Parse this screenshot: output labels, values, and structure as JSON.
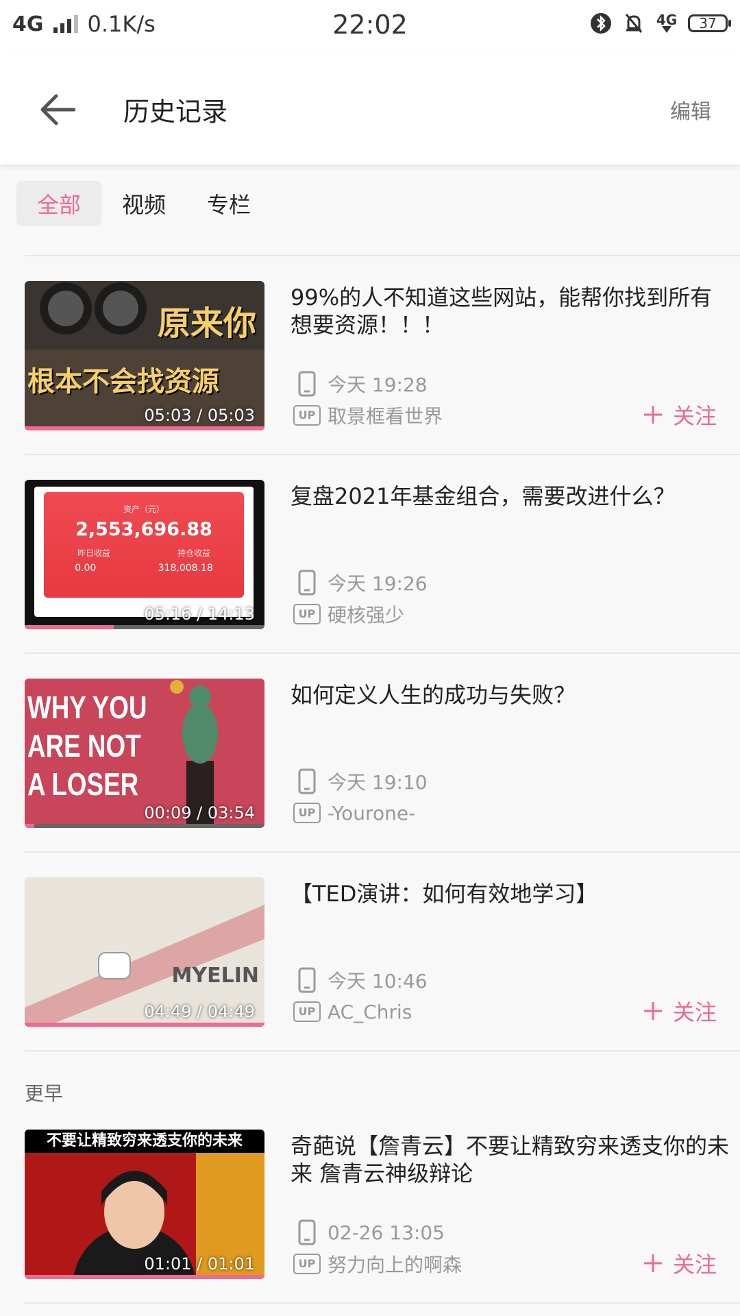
{
  "status_bar": {
    "network": "4G",
    "speed": "0.1K/s",
    "time": "22:02",
    "network_right": "4G",
    "battery": "37"
  },
  "header": {
    "title": "历史记录",
    "edit_label": "编辑"
  },
  "tabs": [
    {
      "label": "全部",
      "active": true
    },
    {
      "label": "视频",
      "active": false
    },
    {
      "label": "专栏",
      "active": false
    }
  ],
  "history": [
    {
      "title": "99%的人不知道这些网站，能帮你找到所有想要资源！！！",
      "duration": "05:03 / 05:03",
      "progress": 1.0,
      "time": "今天 19:28",
      "uploader": "取景框看世界",
      "follow_label": "关注",
      "show_follow": true,
      "thumb_text_1": "原来你",
      "thumb_text_2": "根本不会找资源"
    },
    {
      "title": "复盘2021年基金组合，需要改进什么？",
      "duration": "05:16 / 14:13",
      "progress": 0.37,
      "time": "今天 19:26",
      "uploader": "硬核强少",
      "show_follow": false,
      "thumb_asset_label": "资产（元）",
      "thumb_asset_value": "2,553,696.88",
      "thumb_left_label": "昨日收益",
      "thumb_left_value": "0.00",
      "thumb_right_label": "持仓收益",
      "thumb_right_value": "318,008.18"
    },
    {
      "title": "如何定义人生的成功与失败？",
      "duration": "00:09 / 03:54",
      "progress": 0.04,
      "time": "今天 19:10",
      "uploader": "-Yourone-",
      "show_follow": false,
      "thumb_line_1": "WHY YOU",
      "thumb_line_2": "ARE NOT",
      "thumb_line_3": "A LOSER"
    },
    {
      "title": "【TED演讲：如何有效地学习】",
      "duration": "04:49 / 04:49",
      "progress": 1.0,
      "time": "今天 10:46",
      "uploader": "AC_Chris",
      "follow_label": "关注",
      "show_follow": true,
      "thumb_word": "MYELIN"
    }
  ],
  "earlier_label": "更早",
  "earlier": [
    {
      "title": "奇葩说【詹青云】不要让精致穷来透支你的未来 詹青云神级辩论",
      "duration": "01:01 / 01:01",
      "progress": 1.0,
      "time": "02-26 13:05",
      "uploader": "努力向上的啊森",
      "follow_label": "关注",
      "show_follow": true,
      "thumb_caption": "不要让精致穷来透支你的未来"
    }
  ],
  "colors": {
    "accent": "#f0698f",
    "muted": "#999999"
  }
}
